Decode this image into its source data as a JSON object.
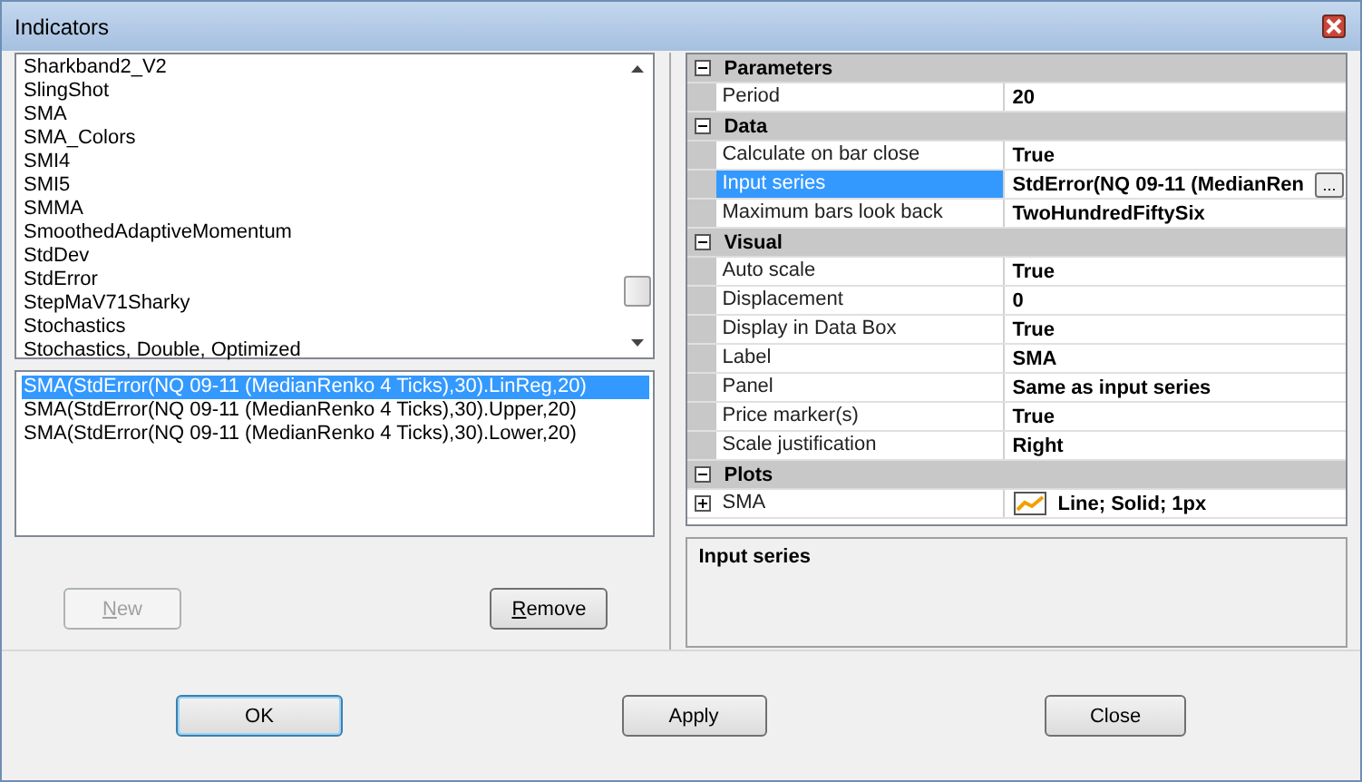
{
  "window": {
    "title": "Indicators"
  },
  "indicator_list": {
    "items": [
      {
        "label": "Sharkband2_V2",
        "selected": false
      },
      {
        "label": "SlingShot",
        "selected": false
      },
      {
        "label": "SMA",
        "selected": false
      },
      {
        "label": "SMA_Colors",
        "selected": false
      },
      {
        "label": "SMI4",
        "selected": false
      },
      {
        "label": "SMI5",
        "selected": false
      },
      {
        "label": "SMMA",
        "selected": false
      },
      {
        "label": "SmoothedAdaptiveMomentum",
        "selected": false
      },
      {
        "label": "StdDev",
        "selected": false
      },
      {
        "label": "StdError",
        "selected": false
      },
      {
        "label": "StepMaV71Sharky",
        "selected": false
      },
      {
        "label": "Stochastics",
        "selected": false
      },
      {
        "label": "Stochastics, Double, Optimized",
        "selected": false
      }
    ]
  },
  "applied_list": {
    "items": [
      {
        "label": "SMA(StdError(NQ 09-11 (MedianRenko 4 Ticks),30).LinReg,20)",
        "selected": true
      },
      {
        "label": "SMA(StdError(NQ 09-11 (MedianRenko 4 Ticks),30).Upper,20)",
        "selected": false
      },
      {
        "label": "SMA(StdError(NQ 09-11 (MedianRenko 4 Ticks),30).Lower,20)",
        "selected": false
      }
    ]
  },
  "left_buttons": [
    {
      "label": "New",
      "disabled": true
    },
    {
      "label": "Remove",
      "disabled": false
    }
  ],
  "properties": [
    {
      "category": "Parameters",
      "expanded": true,
      "rows": [
        {
          "kind": "text",
          "name": "Period",
          "value": "20",
          "selected": false
        }
      ]
    },
    {
      "category": "Data",
      "expanded": true,
      "rows": [
        {
          "kind": "text",
          "name": "Calculate on bar close",
          "value": "True",
          "selected": false
        },
        {
          "kind": "browse",
          "name": "Input series",
          "value": "StdError(NQ 09-11 (MedianRen",
          "browse_label": "...",
          "selected": true
        },
        {
          "kind": "text",
          "name": "Maximum bars look back",
          "value": "TwoHundredFiftySix",
          "selected": false
        }
      ]
    },
    {
      "category": "Visual",
      "expanded": true,
      "rows": [
        {
          "kind": "text",
          "name": "Auto scale",
          "value": "True",
          "selected": false
        },
        {
          "kind": "text",
          "name": "Displacement",
          "value": "0",
          "selected": false
        },
        {
          "kind": "text",
          "name": "Display in Data Box",
          "value": "True",
          "selected": false
        },
        {
          "kind": "text",
          "name": "Label",
          "value": "SMA",
          "selected": false
        },
        {
          "kind": "text",
          "name": "Panel",
          "value": "Same as input series",
          "selected": false
        },
        {
          "kind": "text",
          "name": "Price marker(s)",
          "value": "True",
          "selected": false
        },
        {
          "kind": "text",
          "name": "Scale justification",
          "value": "Right",
          "selected": false
        }
      ]
    },
    {
      "category": "Plots",
      "expanded": true,
      "rows": [
        {
          "kind": "plot",
          "name": "SMA",
          "value": "Line; Solid; 1px",
          "expanded": false,
          "selected": false
        }
      ]
    }
  ],
  "description": {
    "title": "Input series"
  },
  "buttons": [
    {
      "label": "OK",
      "default": true
    },
    {
      "label": "Apply",
      "default": false
    },
    {
      "label": "Close",
      "default": false
    }
  ]
}
